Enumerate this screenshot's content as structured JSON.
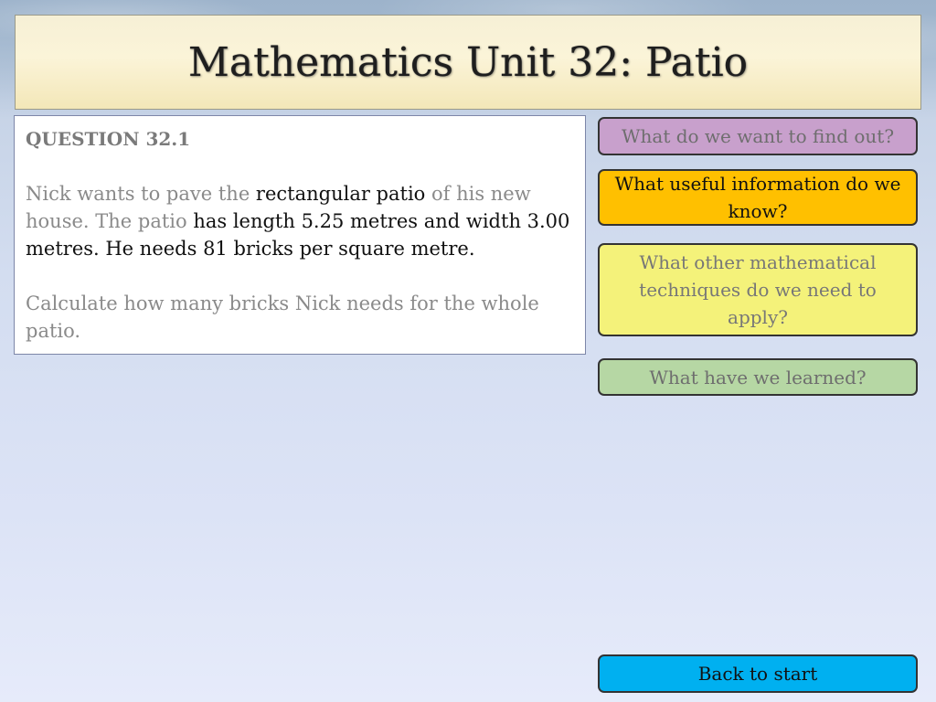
{
  "title": "Mathematics Unit 32: Patio",
  "question": {
    "heading": "QUESTION 32.1",
    "para1": {
      "seg1": "Nick wants to pave the ",
      "seg2": "rectangular patio",
      "seg3": " of his new house.  The patio ",
      "seg4": "has length 5.25 metres and width 3.00 metres.  He needs 81 bricks per square metre."
    },
    "para2": "Calculate how many bricks Nick needs for the whole patio."
  },
  "buttons": {
    "find_out": "What do we want to find out?",
    "useful_info": "What useful information do we know?",
    "techniques": "What other mathematical techniques do we need to apply?",
    "learned": "What have we learned?",
    "back": "Back to start"
  },
  "colors": {
    "find_out": "#c8a0cc",
    "useful_info": "#ffc000",
    "techniques": "#f4f27a",
    "learned": "#b6d7a4",
    "back": "#00b0f0"
  }
}
